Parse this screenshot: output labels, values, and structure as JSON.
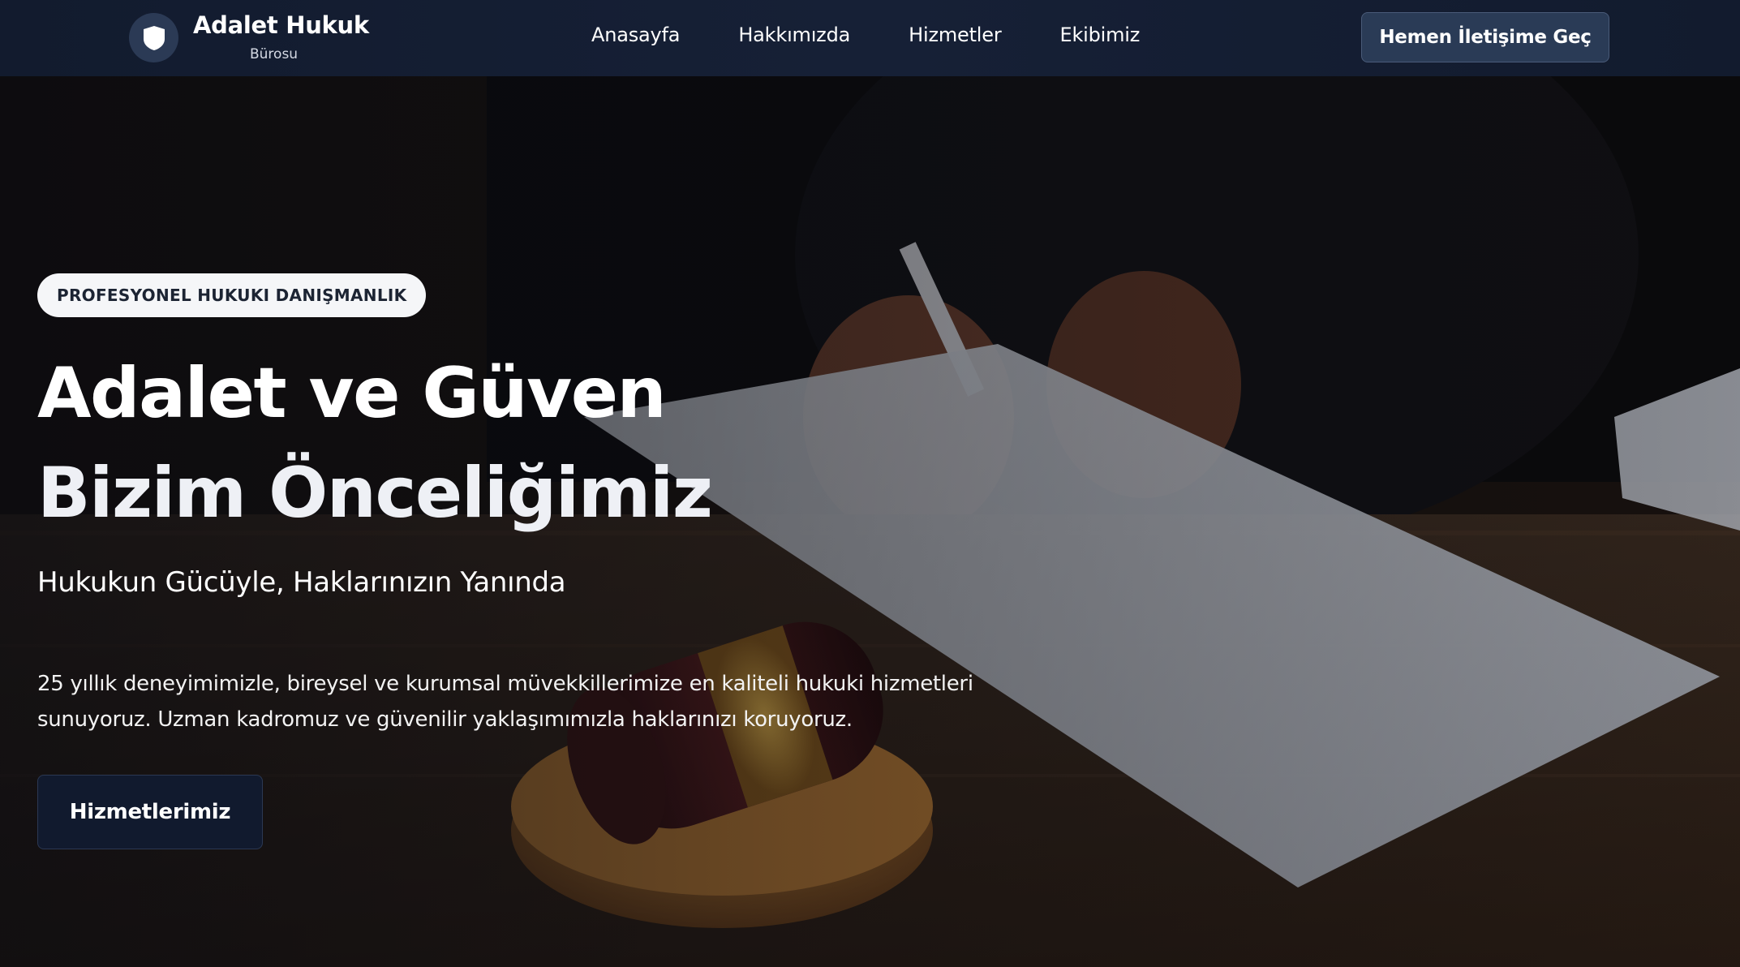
{
  "brand": {
    "name": "Adalet Hukuk",
    "subtitle": "Bürosu",
    "logo_icon": "shield-icon"
  },
  "nav": {
    "links": [
      {
        "label": "Anasayfa"
      },
      {
        "label": "Hakkımızda"
      },
      {
        "label": "Hizmetler"
      },
      {
        "label": "Ekibimiz"
      }
    ],
    "cta_label": "Hemen İletişime Geç"
  },
  "hero": {
    "badge": "PROFESYONEL HUKUKI DANIŞMANLIK",
    "title_line1": "Adalet ve Güven",
    "title_line2": "Bizim Önceliğimiz",
    "subtitle": "Hukukun Gücüyle, Haklarınızın Yanında",
    "description": "25 yıllık deneyimimizle, bireysel ve kurumsal müvekkillerimize en kaliteli hukuki hizmetleri sunuyoruz. Uzman kadromuz ve güvenilir yaklaşımımızla haklarınızı koruyoruz.",
    "button_label": "Hizmetlerimiz",
    "background_image": "lawyer-signing-document-with-gavel"
  },
  "colors": {
    "navbar_bg": "#141d31",
    "cta_bg": "#2a3b56",
    "hero_button_bg": "#111a2e",
    "badge_bg": "#f5f6f8",
    "text_primary": "#ffffff"
  }
}
